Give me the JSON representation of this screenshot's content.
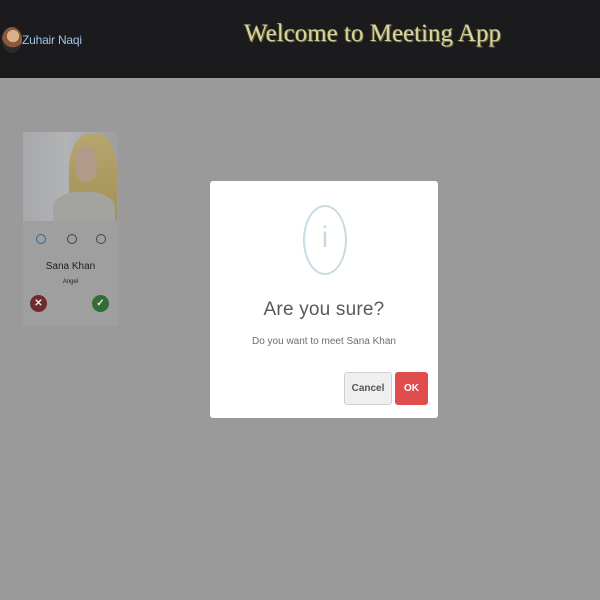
{
  "header": {
    "user_name": "Zuhair Naqi",
    "title": "Welcome to Meeting App"
  },
  "profile_card": {
    "name": "Sana Khan",
    "subtitle": "Angel",
    "reject_icon": "x-icon",
    "accept_icon": "check-icon"
  },
  "dialog": {
    "icon": "info-icon",
    "title": "Are you sure?",
    "message": "Do you want to meet Sana Khan",
    "cancel_label": "Cancel",
    "ok_label": "OK"
  },
  "colors": {
    "header_bg": "#1b1b1d",
    "overlay_bg": "#9a9a9a",
    "ok_button": "#e04d4d",
    "reject_button": "#6e2d2c",
    "accept_button": "#336c35"
  }
}
